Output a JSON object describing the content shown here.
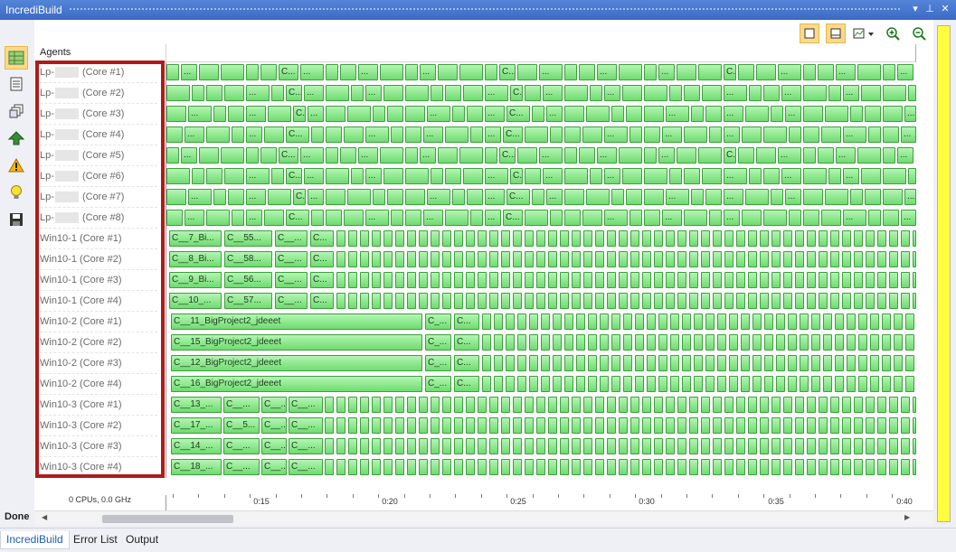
{
  "window": {
    "title": "IncrediBuild",
    "controls": {
      "dropdown": "▾",
      "pin": "⊥",
      "close": "✕"
    }
  },
  "sidebar_tools": [
    {
      "name": "graph-view-icon",
      "active": true
    },
    {
      "name": "report-icon",
      "active": false
    },
    {
      "name": "projects-icon",
      "active": false
    },
    {
      "name": "upload-icon",
      "active": false
    },
    {
      "name": "warning-icon",
      "active": false
    },
    {
      "name": "lightbulb-icon",
      "active": false
    },
    {
      "name": "save-icon",
      "active": false
    }
  ],
  "toolbar": {
    "buttons": [
      {
        "name": "layout-single-button",
        "active": true
      },
      {
        "name": "layout-split-button",
        "active": true
      },
      {
        "name": "graph-dropdown-button",
        "active": false
      },
      {
        "name": "zoom-in-button",
        "active": false
      },
      {
        "name": "zoom-out-button",
        "active": false
      }
    ]
  },
  "agents_header": "Agents",
  "agents": [
    {
      "host": "Lp-",
      "core": "(Core #1)",
      "masked": true
    },
    {
      "host": "Lp-",
      "core": "(Core #2)",
      "masked": true
    },
    {
      "host": "Lp-",
      "core": "(Core #3)",
      "masked": true
    },
    {
      "host": "Lp-",
      "core": "(Core #4)",
      "masked": true
    },
    {
      "host": "Lp-",
      "core": "(Core #5)",
      "masked": true
    },
    {
      "host": "Lp-",
      "core": "(Core #6)",
      "masked": true
    },
    {
      "host": "Lp-",
      "core": "(Core #7)",
      "masked": true
    },
    {
      "host": "Lp-",
      "core": "(Core #8)",
      "masked": true
    },
    {
      "host": "Win10-1",
      "core": "(Core #1)",
      "masked": false
    },
    {
      "host": "Win10-1",
      "core": "(Core #2)",
      "masked": false
    },
    {
      "host": "Win10-1",
      "core": "(Core #3)",
      "masked": false
    },
    {
      "host": "Win10-1",
      "core": "(Core #4)",
      "masked": false
    },
    {
      "host": "Win10-2",
      "core": "(Core #1)",
      "masked": false
    },
    {
      "host": "Win10-2",
      "core": "(Core #2)",
      "masked": false
    },
    {
      "host": "Win10-2",
      "core": "(Core #3)",
      "masked": false
    },
    {
      "host": "Win10-2",
      "core": "(Core #4)",
      "masked": false
    },
    {
      "host": "Win10-3",
      "core": "(Core #1)",
      "masked": false
    },
    {
      "host": "Win10-3",
      "core": "(Core #2)",
      "masked": false
    },
    {
      "host": "Win10-3",
      "core": "(Core #3)",
      "masked": false
    },
    {
      "host": "Win10-3",
      "core": "(Core #4)",
      "masked": false
    }
  ],
  "task_labels": {
    "win10_1": [
      [
        "C__7_Bi...",
        "C__55...",
        "C__...",
        "C..."
      ],
      [
        "C__8_Bi...",
        "C__58...",
        "C__...",
        "C..."
      ],
      [
        "C__9_Bi...",
        "C__56...",
        "C__...",
        "C..."
      ],
      [
        "C__10_...",
        "C__57...",
        "C__...",
        "C..."
      ]
    ],
    "win10_2": [
      [
        "C__11_BigProject2_jdeeet",
        "C_...",
        "C..."
      ],
      [
        "C__15_BigProject2_jdeeet",
        "C_...",
        "C..."
      ],
      [
        "C__12_BigProject2_jdeeet",
        "C_...",
        "C..."
      ],
      [
        "C__16_BigProject2_jdeeet",
        "C_...",
        "C..."
      ]
    ],
    "win10_3": [
      [
        "C__13_...",
        "C__...",
        "C__...",
        "C__..."
      ],
      [
        "C__17_...",
        "C__5...",
        "C__...",
        "C__..."
      ],
      [
        "C__14_...",
        "C__...",
        "C__...",
        "C__..."
      ],
      [
        "C__18_...",
        "C__...",
        "C__...",
        "C__..."
      ]
    ],
    "lp_short": "...",
    "lp_c": "C..."
  },
  "summary": "0 CPUs, 0.0 GHz",
  "timeline_labels": [
    "0:15",
    "0:20",
    "0:25",
    "0:30",
    "0:35",
    "0:40"
  ],
  "status": "Done",
  "bottom_tabs": [
    {
      "label": "IncrediBuild",
      "active": true
    },
    {
      "label": "Error List",
      "active": false
    },
    {
      "label": "Output",
      "active": false
    }
  ],
  "colors": {
    "task_fill": "#7ee87e",
    "highlight_border": "#b01a1a",
    "title_bar": "#3d6fc9",
    "progress_bar": "#ffff40"
  }
}
